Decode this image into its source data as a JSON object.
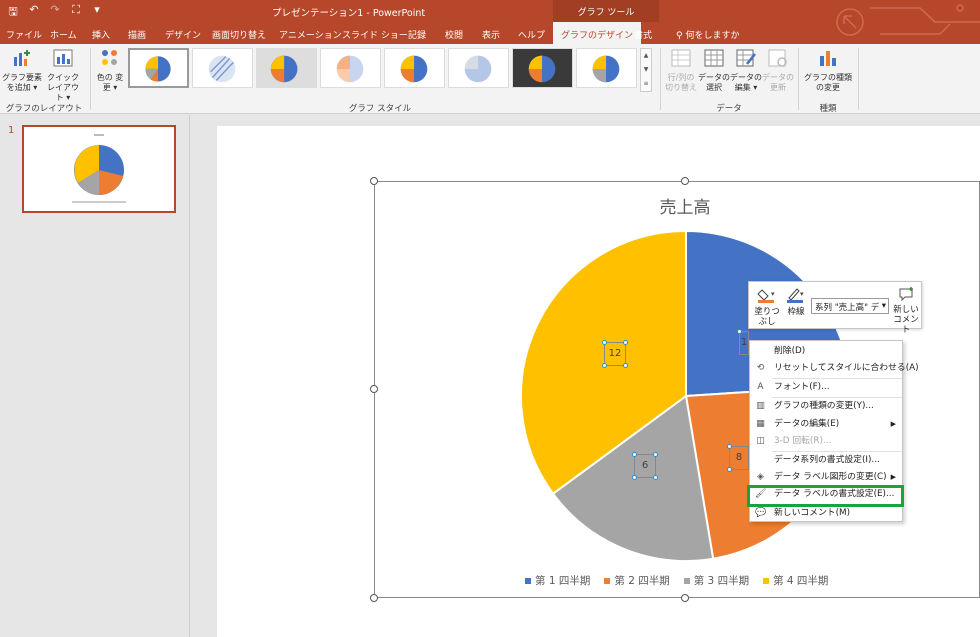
{
  "window": {
    "title": "プレゼンテーション1  -  PowerPoint",
    "context_group": "グラフ ツール"
  },
  "qat": {
    "save": "🖫",
    "undo": "↶",
    "redo": "↷",
    "present": "⛶",
    "more": "▾"
  },
  "tabs": [
    {
      "label": "ファイル",
      "id": "file"
    },
    {
      "label": "ホーム",
      "id": "home"
    },
    {
      "label": "挿入",
      "id": "insert"
    },
    {
      "label": "描画",
      "id": "draw"
    },
    {
      "label": "デザイン",
      "id": "design"
    },
    {
      "label": "画面切り替え",
      "id": "transitions"
    },
    {
      "label": "アニメーション",
      "id": "animations"
    },
    {
      "label": "スライド ショー",
      "id": "slideshow"
    },
    {
      "label": "記録",
      "id": "record"
    },
    {
      "label": "校閲",
      "id": "review"
    },
    {
      "label": "表示",
      "id": "view"
    },
    {
      "label": "ヘルプ",
      "id": "help"
    },
    {
      "label": "グラフのデザイン",
      "id": "chart-design",
      "active": true
    },
    {
      "label": "書式",
      "id": "format"
    },
    {
      "label": "何をしますか",
      "id": "tell-me"
    }
  ],
  "ribbon": {
    "add_element": "グラフ要素を追加 ▾",
    "quick_layout": "クイック レイアウト ▾",
    "layout_group": "グラフのレイアウト",
    "colors": "色の 変更 ▾",
    "style_group": "グラフ スタイル",
    "switch_rowcol": "行/列の 切り替え",
    "select_data": "データの 選択",
    "edit_data": "データの 編集 ▾",
    "refresh_data": "データの 更新",
    "data_group": "データ",
    "change_type": "グラフの種類 の変更",
    "type_group": "種類"
  },
  "slide_panel": {
    "number": "1"
  },
  "chart_data": {
    "type": "pie",
    "title": "売上高",
    "categories": [
      "第 1 四半期",
      "第 2 四半期",
      "第 3 四半期",
      "第 4 四半期"
    ],
    "values": [
      8.2,
      8,
      6,
      12
    ],
    "colors": [
      "#4472c4",
      "#ed7d31",
      "#a5a5a5",
      "#ffc000"
    ],
    "data_labels": [
      "1",
      "8",
      "6",
      "12"
    ],
    "legend": "bottom"
  },
  "mini_toolbar": {
    "fill": "塗りつ ぶし",
    "outline": "枠線",
    "series_select": "系列 \"売上高\" デ",
    "new_comment": "新しい コメント"
  },
  "context_menu": [
    {
      "label": "削除(D)",
      "icon": "",
      "enabled": true
    },
    {
      "label": "リセットしてスタイルに合わせる(A)",
      "icon": "⟲",
      "enabled": true
    },
    {
      "label": "フォント(F)...",
      "icon": "A",
      "enabled": true
    },
    {
      "label": "グラフの種類の変更(Y)...",
      "icon": "▥",
      "enabled": true
    },
    {
      "label": "データの編集(E)",
      "icon": "▦",
      "enabled": true,
      "submenu": true
    },
    {
      "label": "3-D 回転(R)...",
      "icon": "◫",
      "enabled": false
    },
    {
      "label": "データ系列の書式設定(I)...",
      "icon": "",
      "enabled": true
    },
    {
      "label": "データ ラベル図形の変更(C)",
      "icon": "◈",
      "enabled": true,
      "submenu": true
    },
    {
      "label": "データ ラベルの書式設定(E)...",
      "icon": "🖌",
      "enabled": true,
      "highlighted": true
    },
    {
      "label": "新しいコメント(M)",
      "icon": "💬",
      "enabled": true
    }
  ],
  "colors": {
    "brand": "#b7472a",
    "highlight": "#1aa33a"
  }
}
